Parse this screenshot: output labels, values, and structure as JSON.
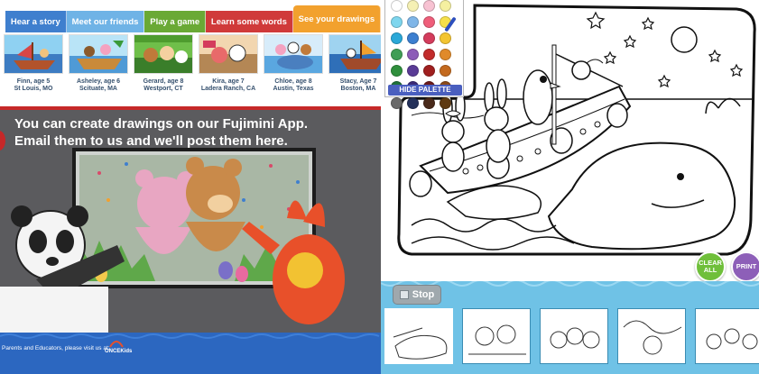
{
  "tabs": [
    {
      "label": "Hear a story",
      "color": "#3f7fce"
    },
    {
      "label": "Meet our friends",
      "color": "#6fb3e6"
    },
    {
      "label": "Play a game",
      "color": "#6aa935"
    },
    {
      "label": "Learn some words",
      "color": "#d03a3a"
    },
    {
      "label": "See your drawings",
      "color": "#f2a12e"
    }
  ],
  "gallery": [
    {
      "name": "Finn, age 5",
      "place": "St Louis, MO"
    },
    {
      "name": "Asheley, age 6",
      "place": "Scituate, MA"
    },
    {
      "name": "Gerard, age 8",
      "place": "Westport, CT"
    },
    {
      "name": "Kira, age 7",
      "place": "Ladera Ranch, CA"
    },
    {
      "name": "Chloe, age 8",
      "place": "Austin, Texas"
    },
    {
      "name": "Stacy, Age 7",
      "place": "Boston, MA"
    }
  ],
  "promo": {
    "line1": "You can create drawings on our Fujimini App.",
    "line2": "Email them to us and we'll post them here."
  },
  "footer": {
    "text": "Parents and Educators, please visit us at:",
    "logo": "ONCEKids"
  },
  "palette": {
    "hide_label": "HIDE PALETTE",
    "colors": [
      "#ffffff",
      "#f5f0b4",
      "#f7c2d2",
      "#f5f0a0",
      "#7ed6ee",
      "#7fb6e8",
      "#ef5e7a",
      "#f6e04a",
      "#2aa8d8",
      "#3c7fd0",
      "#d43c5c",
      "#f3c532",
      "#3f9e56",
      "#8c5cb8",
      "#c22b2b",
      "#e08a2a",
      "#2f8f3c",
      "#5a3b96",
      "#a01f1f",
      "#c46a1e",
      "#1f6f3a",
      "#3a2a78",
      "#6b1a1a",
      "#8a4a1a",
      "#6a6a6a",
      "#23305a",
      "#4a2a1a",
      "#5e3a12"
    ]
  },
  "buttons": {
    "clear": "CLEAR ALL",
    "print": "PRINT",
    "stop": "Stop"
  }
}
